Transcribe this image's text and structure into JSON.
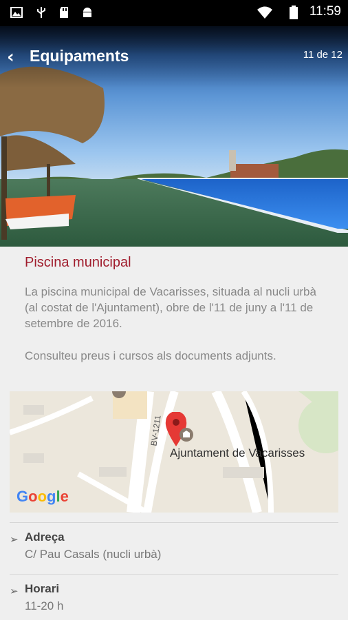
{
  "status_bar": {
    "time": "11:59",
    "icons": [
      "image-icon",
      "usb-icon",
      "sd-card-icon",
      "android-icon",
      "wifi-icon",
      "battery-icon"
    ]
  },
  "app_bar": {
    "title": "Equipaments",
    "counter": "11 de 12",
    "back_icon": "‹"
  },
  "facility": {
    "name": "Piscina municipal",
    "description": "La piscina municipal de Vacarisses, situada al nucli urbà (al costat de l'Ajuntament), obre de l'11 de juny a l'11 de setembre de 2016.",
    "note": "Consulteu preus i cursos als documents adjunts."
  },
  "map": {
    "marker_label": "Ajuntament de Vacarisses",
    "road_label": "BV-1211",
    "brand": "Google",
    "colors": {
      "g1": "#4285f4",
      "g2": "#ea4335",
      "g3": "#fbbc05",
      "g4": "#4285f4",
      "g5": "#34a853",
      "g6": "#ea4335"
    }
  },
  "details": [
    {
      "label": "Adreça",
      "value": "C/ Pau Casals (nucli urbà)"
    },
    {
      "label": "Horari",
      "value": "11-20 h"
    }
  ],
  "colors": {
    "accent": "#a01c2c"
  }
}
